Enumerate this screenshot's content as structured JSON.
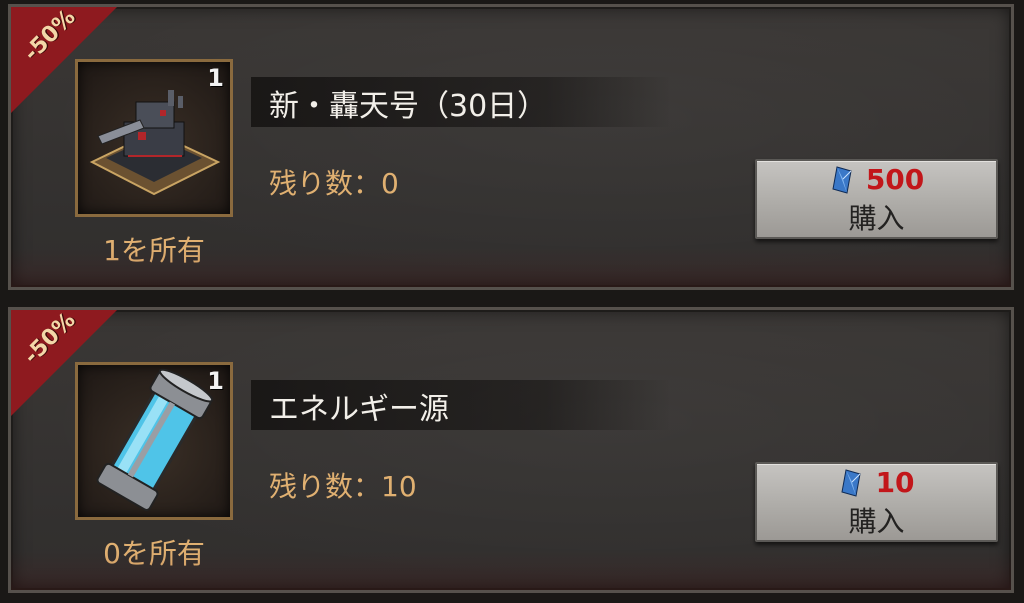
{
  "items": [
    {
      "discount": "-50%",
      "quantity": "1",
      "icon": "tank-icon",
      "owned": "1を所有",
      "name": "新・轟天号（30日）",
      "remaining": "残り数：0",
      "price": "500",
      "currency_icon": "gem-icon",
      "buy_label": "購入"
    },
    {
      "discount": "-50%",
      "quantity": "1",
      "icon": "energy-canister-icon",
      "owned": "0を所有",
      "name": "エネルギー源",
      "remaining": "残り数：10",
      "price": "10",
      "currency_icon": "gem-icon",
      "buy_label": "購入"
    }
  ],
  "colors": {
    "accent_gold": "#e0b071",
    "price_red": "#c2161a",
    "ribbon_red": "#8e1a1f"
  }
}
